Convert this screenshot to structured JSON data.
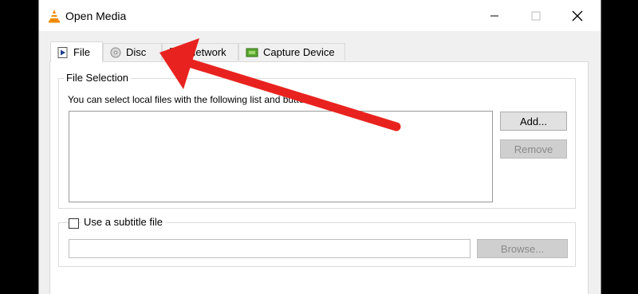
{
  "window": {
    "title": "Open Media"
  },
  "tabs": [
    {
      "label": "File",
      "icon": "play-file-icon",
      "active": true
    },
    {
      "label": "Disc",
      "icon": "disc-icon"
    },
    {
      "label": "Network",
      "icon": "network-icon"
    },
    {
      "label": "Capture Device",
      "icon": "capture-device-icon"
    }
  ],
  "file_selection": {
    "legend": "File Selection",
    "description": "You can select local files with the following list and buttons.",
    "add_label": "Add...",
    "remove_label": "Remove"
  },
  "subtitle": {
    "checkbox_label": "Use a subtitle file",
    "checked": false,
    "browse_label": "Browse..."
  },
  "colors": {
    "annotation_arrow": "#e8231f",
    "vlc_orange": "#f18a00"
  }
}
